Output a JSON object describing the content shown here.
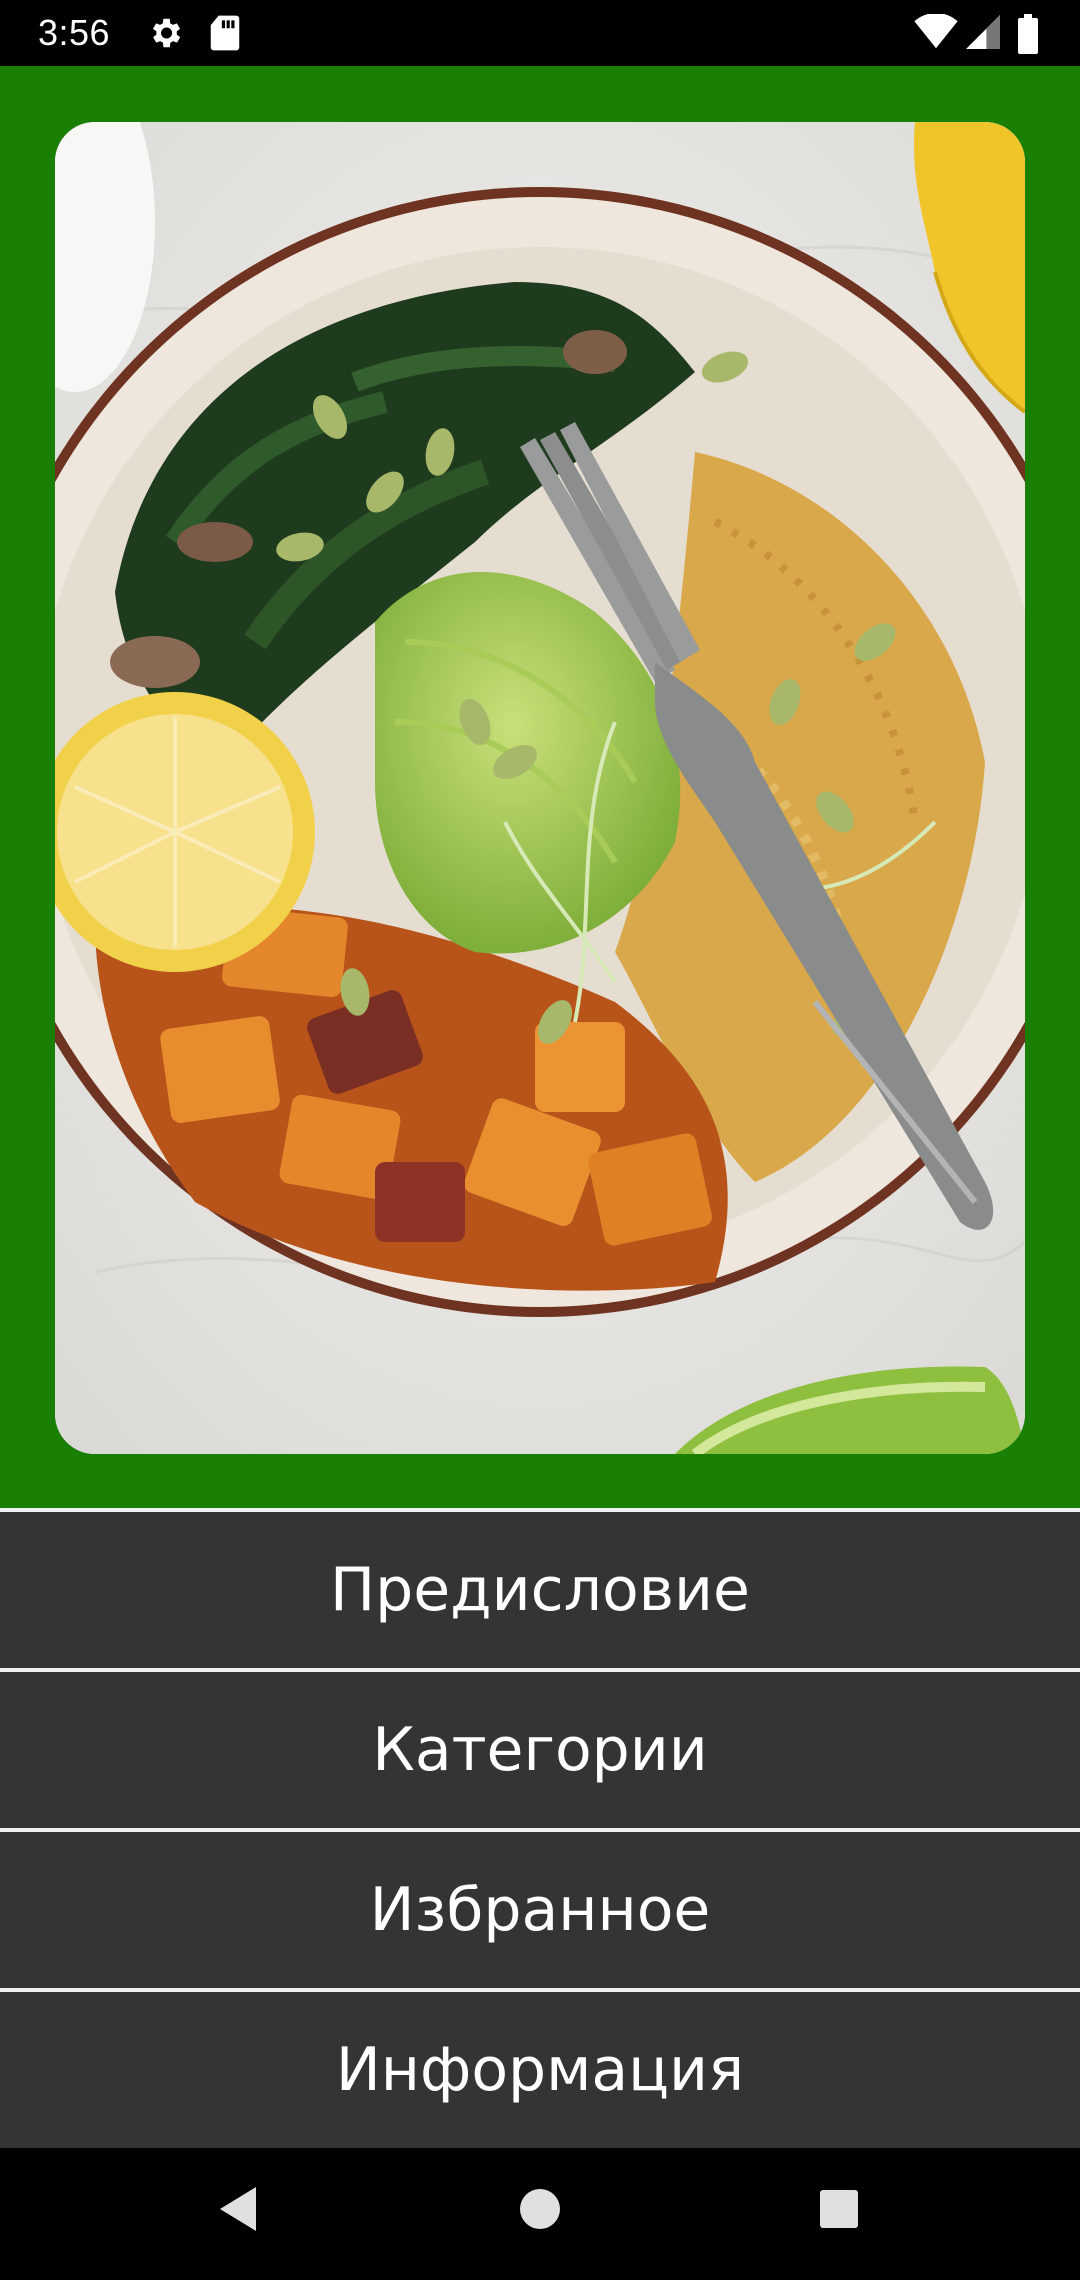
{
  "status_bar": {
    "time": "3:56",
    "icons": [
      "gear-icon",
      "sd-card-icon",
      "wifi-icon",
      "signal-icon",
      "battery-icon"
    ]
  },
  "colors": {
    "header_bg": "#1a7f05",
    "menu_bg": "#343434",
    "menu_text": "#ffffff"
  },
  "hero": {
    "image": "food-bowl-photo"
  },
  "menu": {
    "items": [
      {
        "label": "Предисловие"
      },
      {
        "label": "Категории"
      },
      {
        "label": "Избранное"
      },
      {
        "label": "Информация"
      }
    ]
  },
  "nav_bar": {
    "buttons": [
      "back-icon",
      "home-icon",
      "recents-icon"
    ]
  }
}
